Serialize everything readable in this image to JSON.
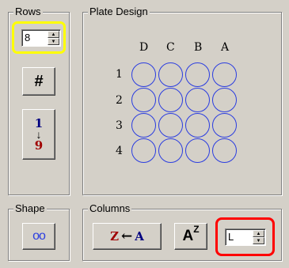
{
  "rows_group": {
    "title": "Rows",
    "spinner_value": "8",
    "grid_button_label": "#",
    "order_button": {
      "top": "1",
      "bottom": "9"
    }
  },
  "plate_group": {
    "title": "Plate Design",
    "column_labels": [
      "D",
      "C",
      "B",
      "A"
    ],
    "row_labels": [
      "1",
      "2",
      "3",
      "4"
    ]
  },
  "shape_group": {
    "title": "Shape",
    "shape_button_label": "oo"
  },
  "columns_group": {
    "title": "Columns",
    "order_button": {
      "left": "Z",
      "right": "A"
    },
    "sort_button": {
      "base": "A",
      "sup": "Z"
    },
    "spinner_value": "L"
  },
  "colors": {
    "highlight_yellow": "#ffff00",
    "highlight_red": "#ff0000",
    "well_blue": "#2b3de0",
    "dark_red": "#a00000",
    "navy": "#000080"
  },
  "icons": [
    "arrow-down-icon",
    "arrow-left-icon",
    "grid-icon"
  ]
}
